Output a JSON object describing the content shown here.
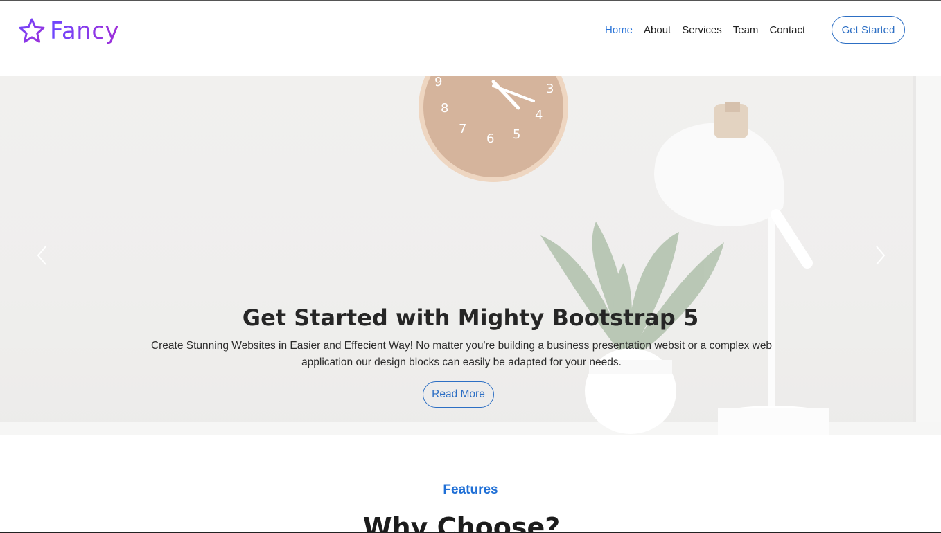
{
  "brand": {
    "name": "Fancy",
    "icon": "star-outline-icon"
  },
  "nav": {
    "items": [
      {
        "label": "Home",
        "active": true
      },
      {
        "label": "About",
        "active": false
      },
      {
        "label": "Services",
        "active": false
      },
      {
        "label": "Team",
        "active": false
      },
      {
        "label": "Contact",
        "active": false
      }
    ],
    "cta_label": "Get Started"
  },
  "hero": {
    "title": "Get Started with Mighty Bootstrap 5",
    "description": "Create Stunning Websites in Easier and Effecient Way! No matter you're building a business presentation websit or a complex web application our design blocks can easily be adapted for your needs.",
    "button_label": "Read More",
    "prev_icon": "chevron-left-icon",
    "next_icon": "chevron-right-icon",
    "clock_numbers": [
      "9",
      "3",
      "8",
      "4",
      "7",
      "6",
      "5"
    ]
  },
  "features": {
    "label": "Features",
    "title": "Why Choose?"
  },
  "colors": {
    "accent": "#2d6fc4",
    "brand_start": "#6c47ff",
    "brand_end": "#a02fd8",
    "features_label": "#1f6fd6"
  }
}
